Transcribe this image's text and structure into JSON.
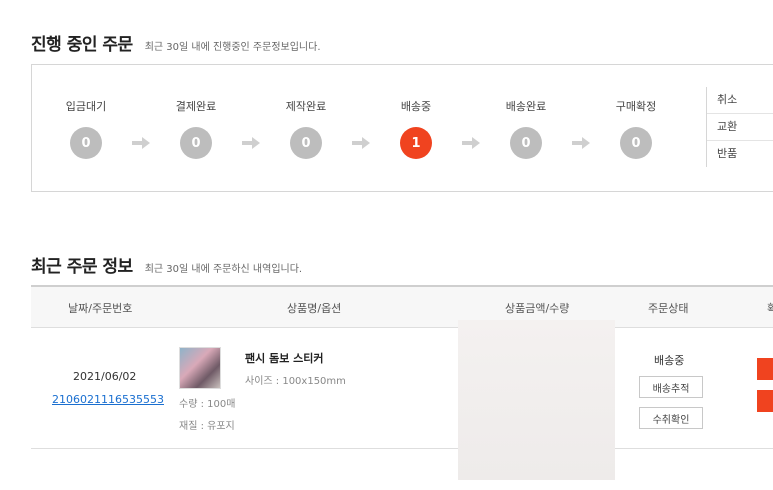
{
  "progress": {
    "title": "진행 중인 주문",
    "subtitle": "최근 30일 내에 진행중인 주문정보입니다.",
    "steps": [
      {
        "label": "입금대기",
        "count": "0"
      },
      {
        "label": "결제완료",
        "count": "0"
      },
      {
        "label": "제작완료",
        "count": "0"
      },
      {
        "label": "배송중",
        "count": "1"
      },
      {
        "label": "배송완료",
        "count": "0"
      },
      {
        "label": "구매확정",
        "count": "0"
      }
    ],
    "side": [
      "취소",
      "교환",
      "반품"
    ],
    "active_color": "#f0431f",
    "inactive_color": "#bdbdbd"
  },
  "recent": {
    "title": "최근 주문 정보",
    "subtitle": "최근 30일 내에 주문하신 내역입니다.",
    "headers": {
      "date_order": "날짜/주문번호",
      "product": "상품명/옵션",
      "price_qty": "상품금액/수량",
      "status": "주문상태",
      "last": "확"
    },
    "order": {
      "date": "2021/06/02",
      "order_no": "2106021116535553",
      "product_name": "팬시 돔보 스티커",
      "option": "사이즈 : 100x150mm",
      "quantity": "수량 : 100매",
      "material": "재질 : 유포지",
      "status": "배송중",
      "track_button": "배송추적",
      "confirm_button": "수취확인"
    }
  }
}
